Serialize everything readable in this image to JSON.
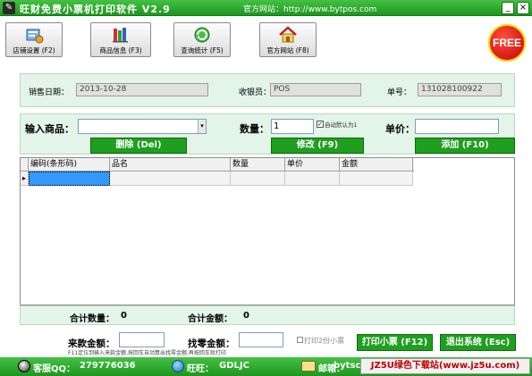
{
  "window": {
    "title": "旺财免费小票机打印软件 V2.9",
    "website_label": "官方网站：http://www.bytpos.com",
    "minimize_glyph": "_",
    "close_glyph": "×"
  },
  "toolbar": {
    "shop_settings": "店铺设置 (F2)",
    "goods_info": "商品信息 (F3)",
    "query_stats": "查询统计 (F5)",
    "official_site": "官方网站 (F8)",
    "free_badge": "FREE"
  },
  "info": {
    "date_label": "销售日期：",
    "date_value": "2013-10-28",
    "cashier_label": "收银员：",
    "cashier_value": "POS",
    "order_label": "单号：",
    "order_value": "131028100922"
  },
  "entry": {
    "goods_label": "输入商品：",
    "goods_value": "",
    "qty_label": "数量：",
    "qty_value": "1",
    "auto_default_label": "自动默认为1",
    "auto_default_checked": true,
    "price_label": "单价：",
    "price_value": "",
    "delete_button": "删除 (Del)",
    "modify_button": "修改 (F9)",
    "add_button": "添加 (F10)"
  },
  "grid": {
    "columns": [
      "编码(条形码)",
      "品名",
      "数量",
      "单价",
      "金额"
    ],
    "row_indicator": "▸"
  },
  "totals": {
    "qty_label": "合计数量：",
    "qty_value": "0",
    "amount_label": "合计金额：",
    "amount_value": "0"
  },
  "payment": {
    "received_label": "来款金额：",
    "received_value": "",
    "change_label": "找零金额：",
    "change_value": "",
    "print_two_label": "打印2份小票",
    "print_two_checked": false,
    "hint": "F11定位到输入来款金额,按回车自动算出找零金额,再按回车就打印",
    "print_button": "打印小票 (F12)",
    "exit_button": "退出系统 (Esc)"
  },
  "statusbar": {
    "qq_label": "客服QQ：",
    "qq_value": "279776036",
    "wangwang_label": "旺旺：",
    "wangwang_value": "GDLJC",
    "email_label": "邮箱：",
    "email_value": "bytsc",
    "watermark": "JZ5U绿色下载站(www.jz5u.com)"
  },
  "colors": {
    "accent_green": "#1f9e1f",
    "panel_bg": "#e3f4e8",
    "free_red": "#c40000"
  }
}
